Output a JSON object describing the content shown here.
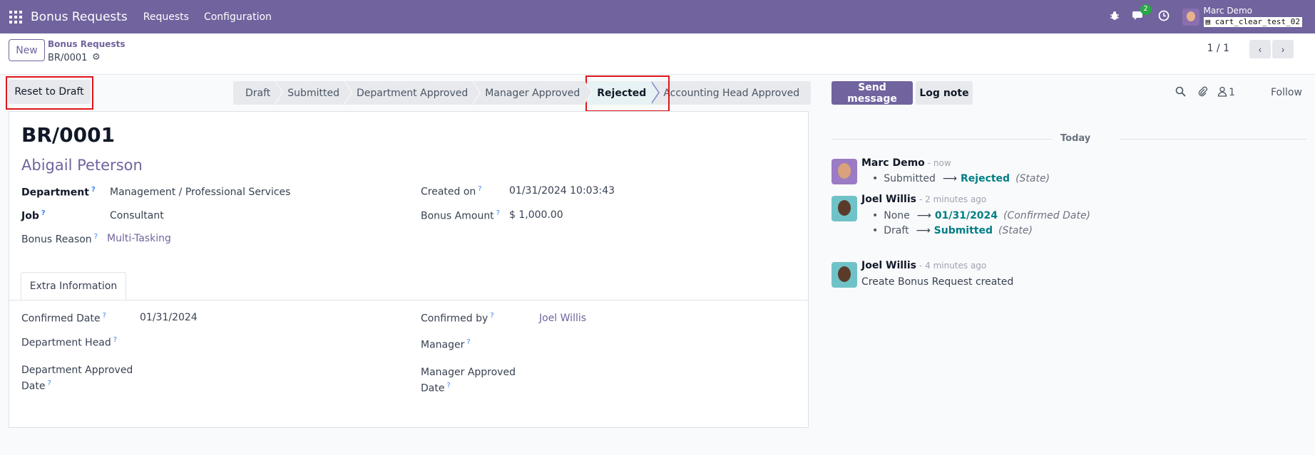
{
  "navbar": {
    "brand": "Bonus Requests",
    "menus": [
      "Requests",
      "Configuration"
    ],
    "message_badge": "2",
    "user_name": "Marc Demo",
    "database": "cart_clear_test_02"
  },
  "control_panel": {
    "new_label": "New",
    "breadcrumb_parent": "Bonus Requests",
    "breadcrumb_current": "BR/0001",
    "pager": "1 / 1"
  },
  "statusbar": {
    "reset_label": "Reset to Draft",
    "stages": [
      "Draft",
      "Submitted",
      "Department Approved",
      "Manager Approved",
      "Rejected",
      "Accounting Head Approved"
    ],
    "active_stage": "Rejected"
  },
  "form": {
    "title": "BR/0001",
    "employee": "Abigail Peterson",
    "department_label": "Department",
    "department_value": "Management / Professional Services",
    "job_label": "Job",
    "job_value": "Consultant",
    "bonus_reason_label": "Bonus Reason",
    "bonus_reason_value": "Multi-Tasking",
    "created_on_label": "Created on",
    "created_on_value": "01/31/2024 10:03:43",
    "bonus_amount_label": "Bonus Amount",
    "bonus_amount_value": "$ 1,000.00",
    "help_mark": "?",
    "tab_label": "Extra Information",
    "confirmed_date_label": "Confirmed Date",
    "confirmed_date_value": "01/31/2024",
    "department_head_label": "Department Head",
    "department_approved_date_label_1": "Department Approved",
    "department_approved_date_label_2": "Date",
    "confirmed_by_label": "Confirmed by",
    "confirmed_by_value": "Joel Willis",
    "manager_label": "Manager",
    "manager_approved_date_label_1": "Manager Approved",
    "manager_approved_date_label_2": "Date"
  },
  "chatter": {
    "send_message_label": "Send message",
    "log_note_label": "Log note",
    "follower_count": "1",
    "follow_label": "Follow",
    "today_label": "Today",
    "messages": [
      {
        "author": "Marc Demo",
        "time": "- now",
        "tracking": [
          {
            "old": "Submitted",
            "new": "Rejected",
            "field": "(State)"
          }
        ]
      },
      {
        "author": "Joel Willis",
        "time": "- 2 minutes ago",
        "tracking": [
          {
            "old": "None",
            "new": "01/31/2024",
            "field": "(Confirmed Date)"
          },
          {
            "old": "Draft",
            "new": "Submitted",
            "field": "(State)"
          }
        ]
      },
      {
        "author": "Joel Willis",
        "time": "- 4 minutes ago",
        "body": "Create Bonus Request created"
      }
    ]
  },
  "colors": {
    "brand": "#71639e",
    "highlight_box": "#e0161b",
    "tracking_value": "#017e84"
  }
}
